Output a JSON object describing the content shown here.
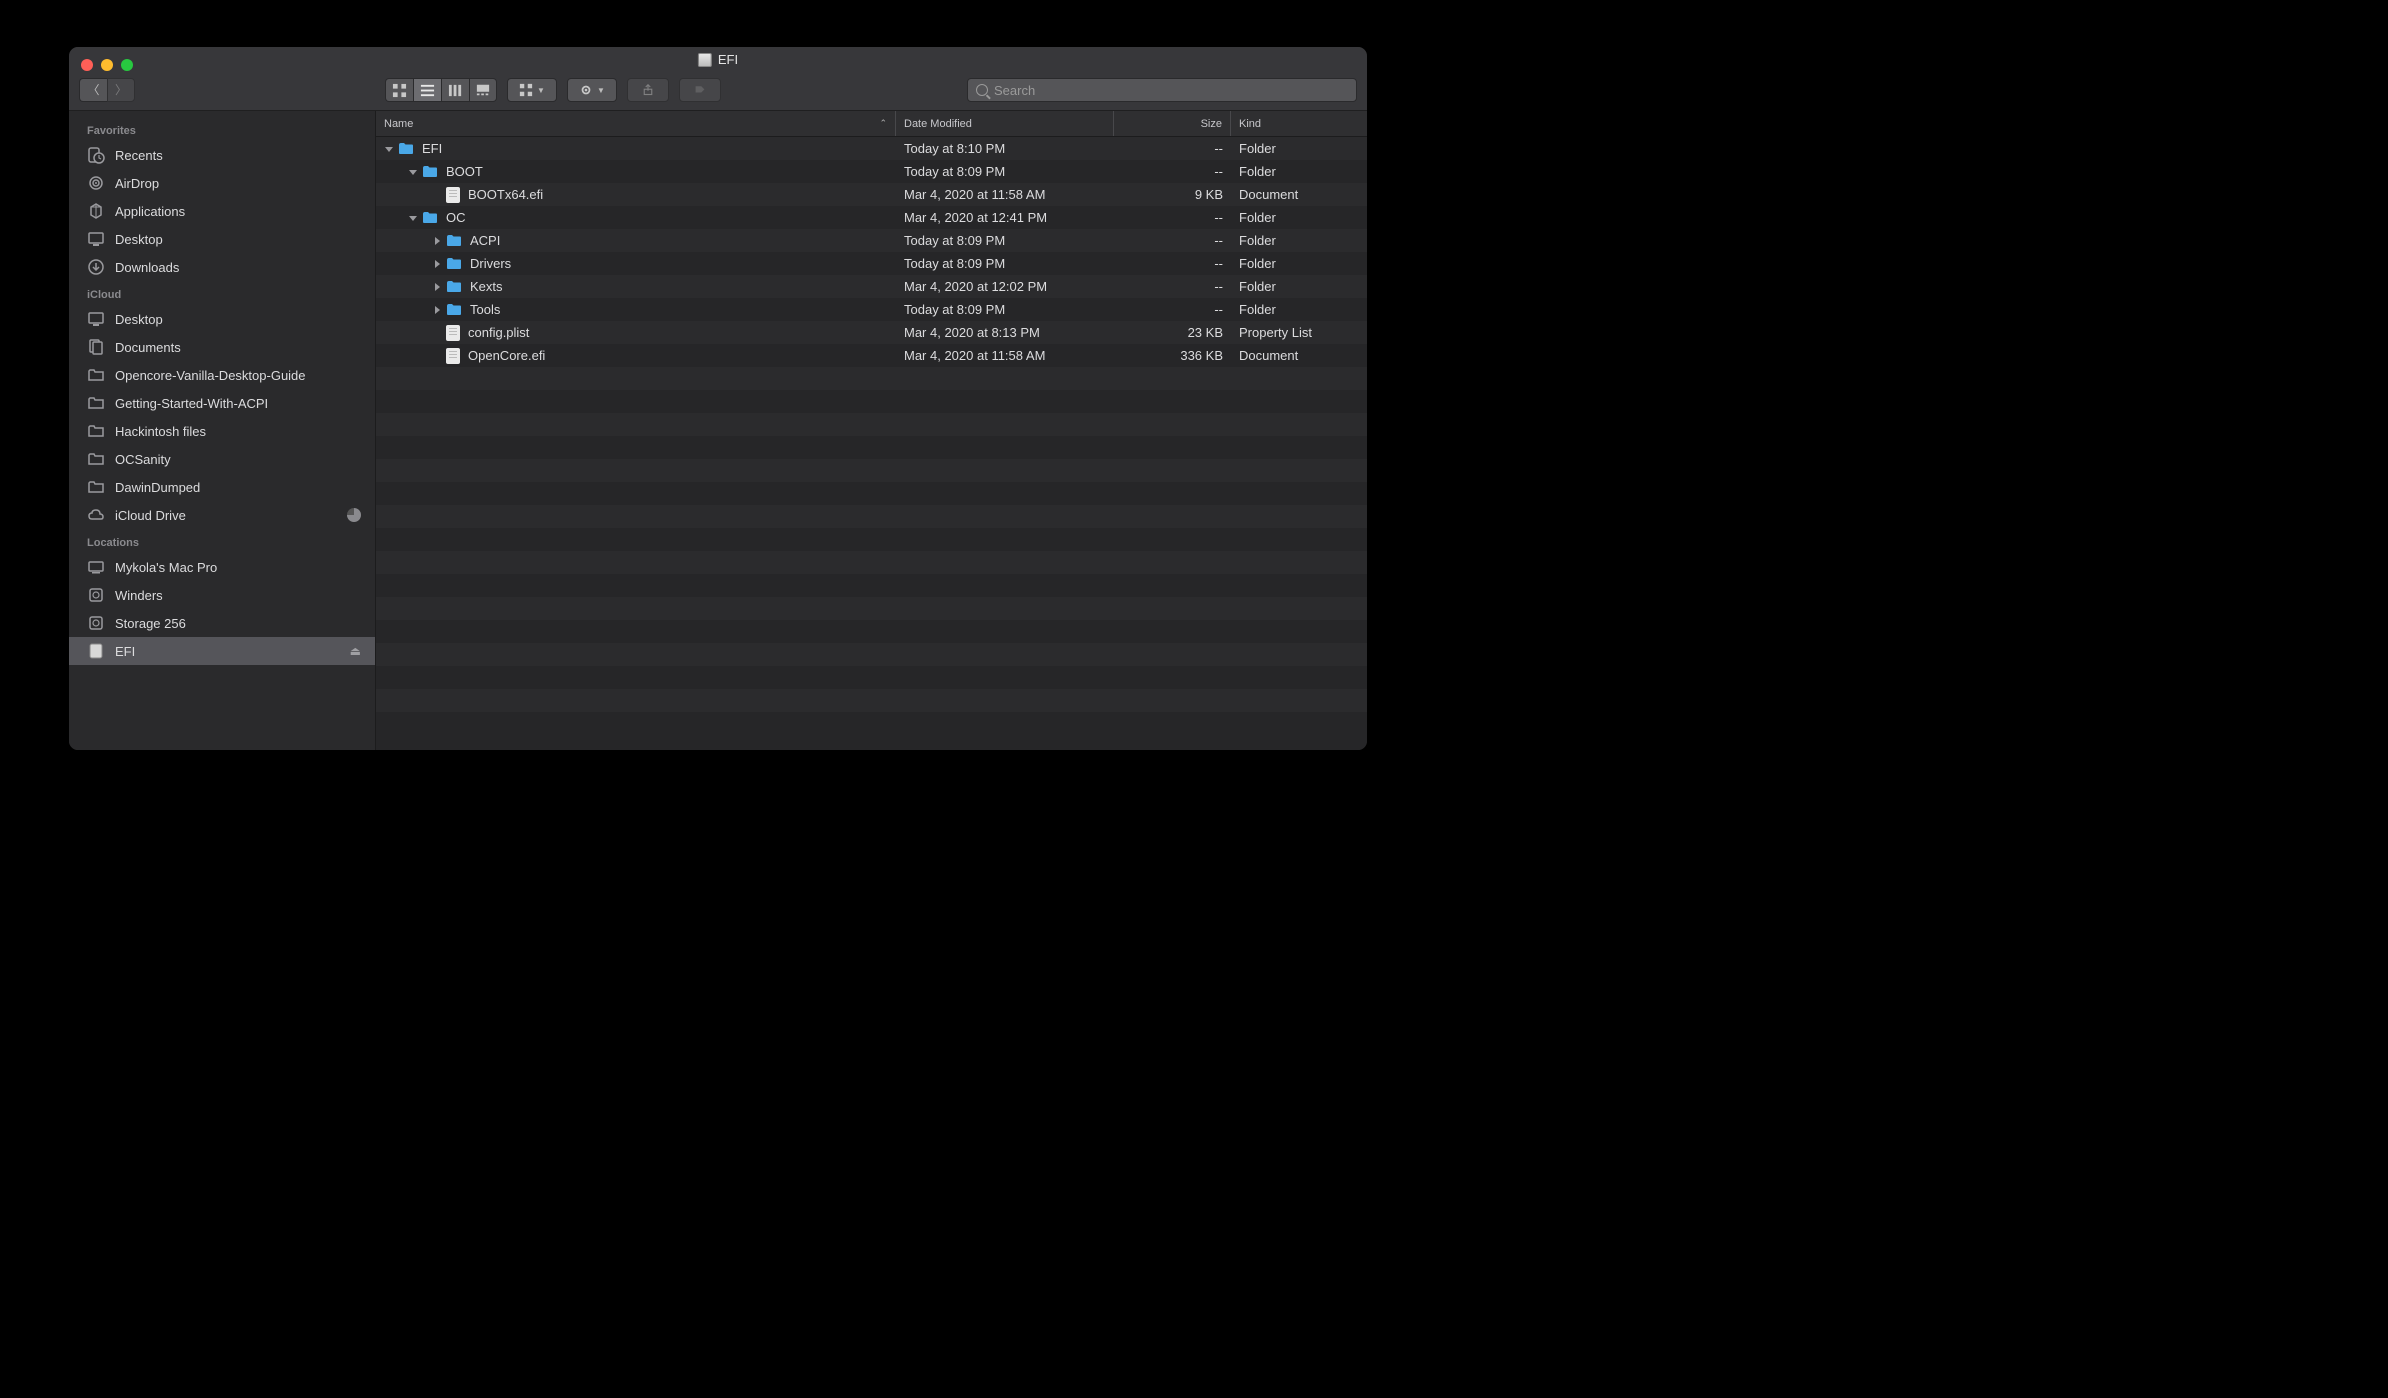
{
  "window": {
    "title": "EFI"
  },
  "search": {
    "placeholder": "Search"
  },
  "columns": {
    "name": "Name",
    "date": "Date Modified",
    "size": "Size",
    "kind": "Kind"
  },
  "sidebar": {
    "sections": [
      {
        "header": "Favorites",
        "items": [
          {
            "label": "Recents",
            "icon": "clock-doc"
          },
          {
            "label": "AirDrop",
            "icon": "airdrop"
          },
          {
            "label": "Applications",
            "icon": "apps"
          },
          {
            "label": "Desktop",
            "icon": "desktop"
          },
          {
            "label": "Downloads",
            "icon": "download"
          }
        ]
      },
      {
        "header": "iCloud",
        "items": [
          {
            "label": "Desktop",
            "icon": "desktop"
          },
          {
            "label": "Documents",
            "icon": "documents"
          },
          {
            "label": "Opencore-Vanilla-Desktop-Guide",
            "icon": "folder"
          },
          {
            "label": "Getting-Started-With-ACPI",
            "icon": "folder"
          },
          {
            "label": "Hackintosh files",
            "icon": "folder"
          },
          {
            "label": "OCSanity",
            "icon": "folder"
          },
          {
            "label": "DawinDumped",
            "icon": "folder"
          },
          {
            "label": "iCloud Drive",
            "icon": "cloud",
            "pie": true
          }
        ]
      },
      {
        "header": "Locations",
        "items": [
          {
            "label": "Mykola's Mac Pro",
            "icon": "computer"
          },
          {
            "label": "Winders",
            "icon": "hdd"
          },
          {
            "label": "Storage 256",
            "icon": "hdd"
          },
          {
            "label": "EFI",
            "icon": "disk",
            "selected": true,
            "eject": true
          }
        ]
      }
    ]
  },
  "rows": [
    {
      "indent": 0,
      "disclosure": "open",
      "icon": "folder",
      "name": "EFI",
      "date": "Today at 8:10 PM",
      "size": "--",
      "kind": "Folder"
    },
    {
      "indent": 1,
      "disclosure": "open",
      "icon": "folder",
      "name": "BOOT",
      "date": "Today at 8:09 PM",
      "size": "--",
      "kind": "Folder"
    },
    {
      "indent": 2,
      "disclosure": "none",
      "icon": "file",
      "name": "BOOTx64.efi",
      "date": "Mar 4, 2020 at 11:58 AM",
      "size": "9 KB",
      "kind": "Document"
    },
    {
      "indent": 1,
      "disclosure": "open",
      "icon": "folder",
      "name": "OC",
      "date": "Mar 4, 2020 at 12:41 PM",
      "size": "--",
      "kind": "Folder"
    },
    {
      "indent": 2,
      "disclosure": "closed",
      "icon": "folder",
      "name": "ACPI",
      "date": "Today at 8:09 PM",
      "size": "--",
      "kind": "Folder"
    },
    {
      "indent": 2,
      "disclosure": "closed",
      "icon": "folder",
      "name": "Drivers",
      "date": "Today at 8:09 PM",
      "size": "--",
      "kind": "Folder"
    },
    {
      "indent": 2,
      "disclosure": "closed",
      "icon": "folder",
      "name": "Kexts",
      "date": "Mar 4, 2020 at 12:02 PM",
      "size": "--",
      "kind": "Folder"
    },
    {
      "indent": 2,
      "disclosure": "closed",
      "icon": "folder",
      "name": "Tools",
      "date": "Today at 8:09 PM",
      "size": "--",
      "kind": "Folder"
    },
    {
      "indent": 2,
      "disclosure": "none",
      "icon": "file",
      "name": "config.plist",
      "date": "Mar 4, 2020 at 8:13 PM",
      "size": "23 KB",
      "kind": "Property List"
    },
    {
      "indent": 2,
      "disclosure": "none",
      "icon": "file",
      "name": "OpenCore.efi",
      "date": "Mar 4, 2020 at 11:58 AM",
      "size": "336 KB",
      "kind": "Document"
    }
  ]
}
